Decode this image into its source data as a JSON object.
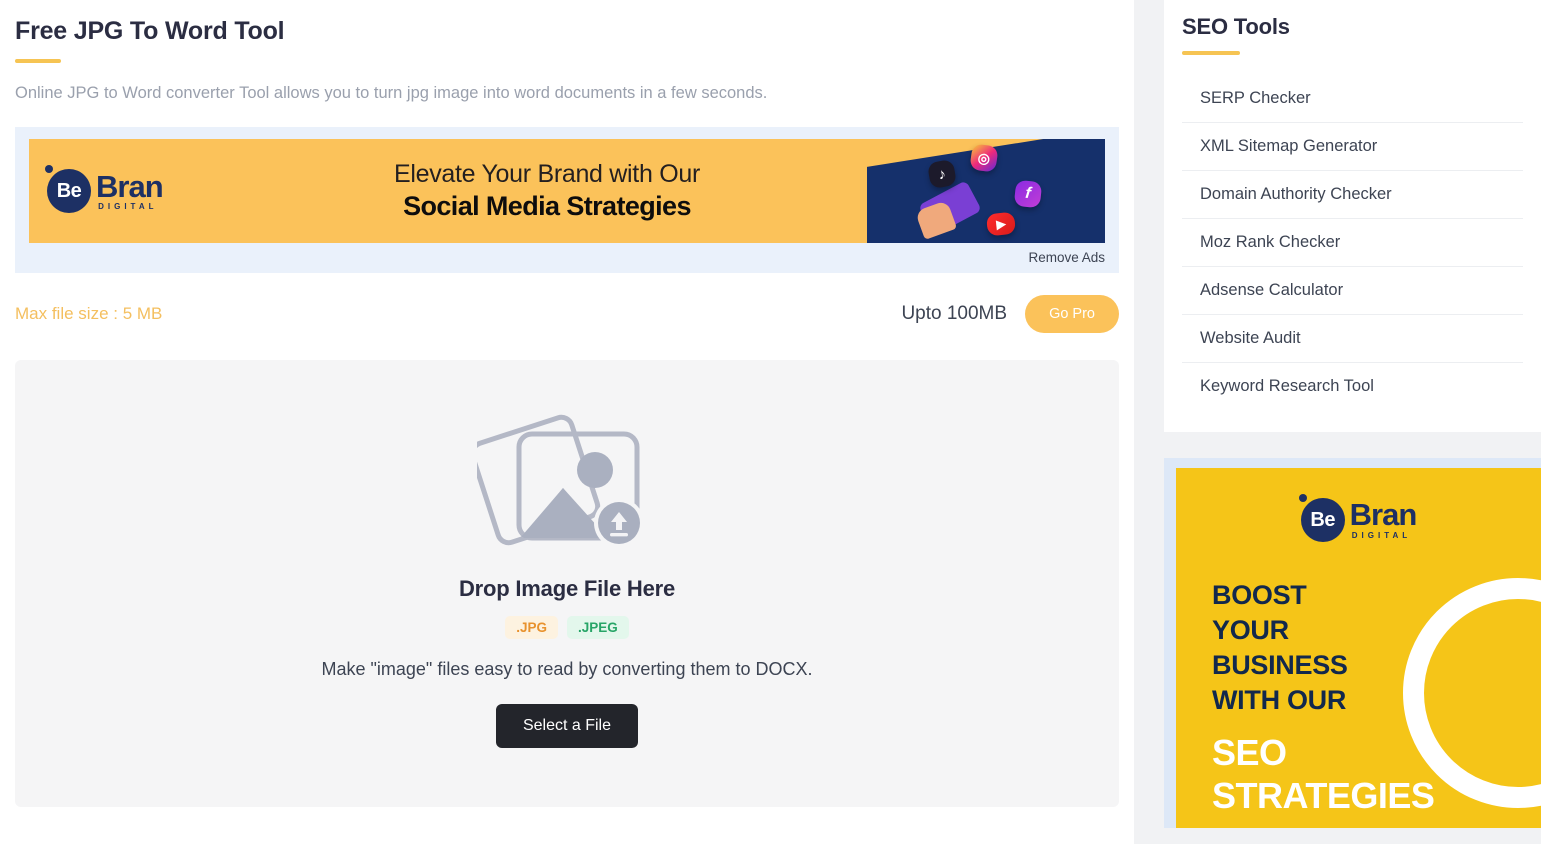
{
  "main": {
    "title": "Free JPG To Word Tool",
    "subtitle": "Online JPG to Word converter Tool allows you to turn jpg image into word documents in a few seconds.",
    "ad": {
      "logo_be": "Be",
      "logo_bran": "Bran",
      "logo_digital": "DIGITAL",
      "line1": "Elevate Your Brand with Our",
      "line2": "Social Media Strategies",
      "remove_ads": "Remove Ads",
      "icons": [
        "tiktok-icon",
        "instagram-icon",
        "facebook-icon",
        "youtube-icon"
      ]
    },
    "limits": {
      "max_file_size": "Max file size : 5 MB",
      "upto": "Upto 100MB",
      "go_pro": "Go Pro"
    },
    "dropzone": {
      "icon": "image-upload-icon",
      "title": "Drop Image File Here",
      "badges": [
        {
          "label": ".JPG",
          "color": "#e8922e",
          "bg": "#fdf2e0"
        },
        {
          "label": ".JPEG",
          "color": "#27a567",
          "bg": "#e3f7ec"
        }
      ],
      "description": "Make \"image\" files easy to read by converting them to DOCX.",
      "select_button": "Select a File"
    }
  },
  "sidebar": {
    "title": "SEO Tools",
    "items": [
      {
        "label": "SERP Checker"
      },
      {
        "label": "XML Sitemap Generator"
      },
      {
        "label": "Domain Authority Checker"
      },
      {
        "label": "Moz Rank Checker"
      },
      {
        "label": "Adsense Calculator"
      },
      {
        "label": "Website Audit"
      },
      {
        "label": "Keyword Research Tool"
      }
    ],
    "ad": {
      "logo_be": "Be",
      "logo_bran": "Bran",
      "logo_digital": "DIGITAL",
      "headline": "BOOST\nYOUR\nBUSINESS\nWITH OUR",
      "emphasis": "SEO\nSTRATEGIES"
    }
  },
  "colors": {
    "accent_yellow": "#f6c453",
    "ad_orange": "#fbc25a",
    "ad_yellow": "#f5c518",
    "brand_navy": "#1d3064",
    "text_dark": "#2b2d42",
    "text_muted": "#9aa0ad",
    "dropzone_bg": "#f5f5f6",
    "button_dark": "#23252b",
    "ad_bg_blue": "#eaf1fb"
  }
}
